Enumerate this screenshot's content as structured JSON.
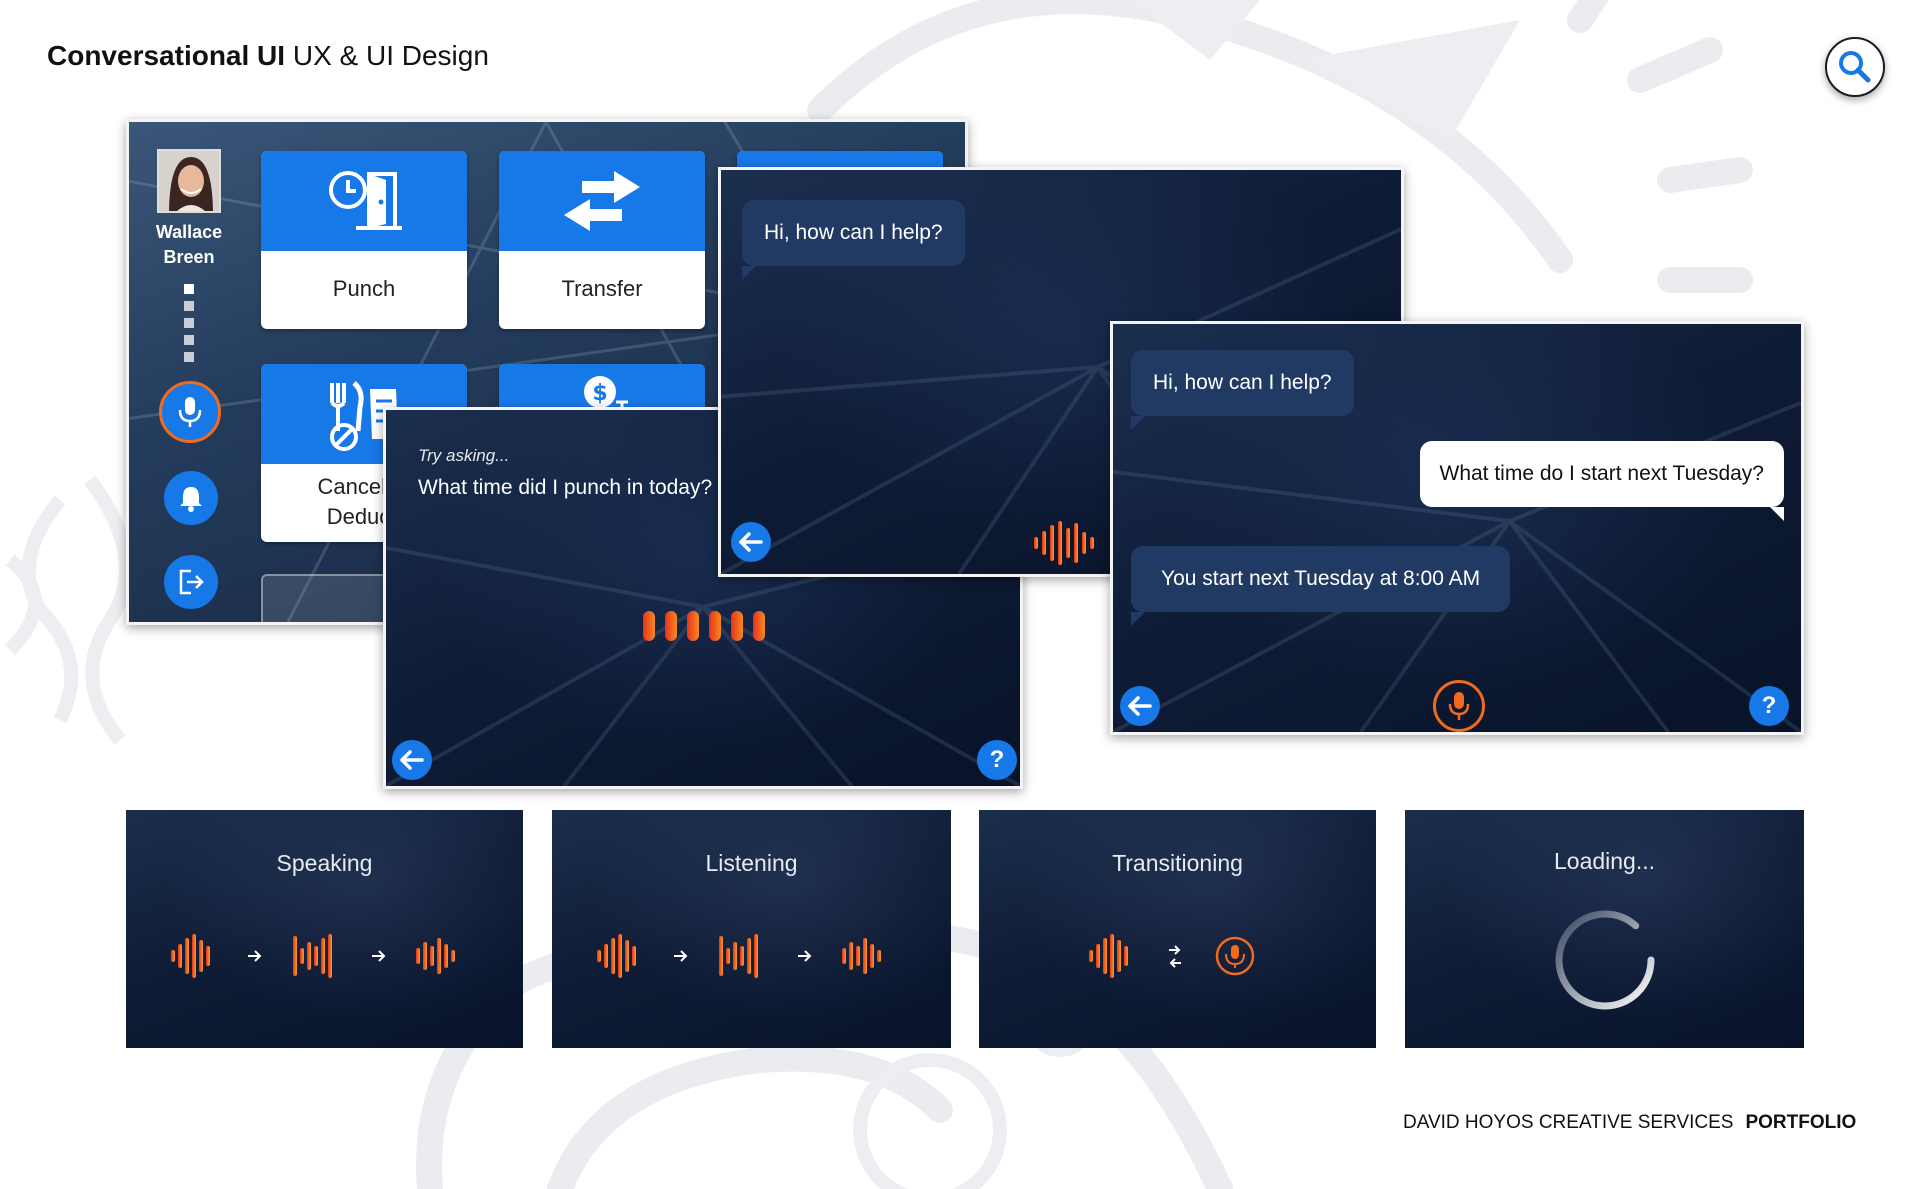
{
  "header": {
    "title_bold": "Conversational UI",
    "title_rest": " UX & UI Design"
  },
  "home_screen": {
    "user_first": "Wallace",
    "user_last": "Breen",
    "tiles": [
      {
        "label": "Punch"
      },
      {
        "label": "Transfer"
      },
      {
        "label": "Cancel M\nDeducti"
      }
    ]
  },
  "listen_screen": {
    "hint": "Try asking...",
    "suggestion": "What time did I punch in today?"
  },
  "greet_screen": {
    "greeting": "Hi, how can I help?"
  },
  "conversation": {
    "greeting": "Hi, how can I help?",
    "user_message": "What time do I start next Tuesday?",
    "reply": "You start next Tuesday at 8:00 AM",
    "help_label": "?"
  },
  "states": [
    {
      "title": "Speaking"
    },
    {
      "title": "Listening"
    },
    {
      "title": "Transitioning"
    },
    {
      "title": "Loading..."
    }
  ],
  "footer": {
    "company": "DAVID HOYOS CREATIVE SERVICES",
    "section": "PORTFOLIO"
  },
  "colors": {
    "accent_blue": "#1778e8",
    "voice_orange": "#f26a1b",
    "voice_red": "#e8321e",
    "screen_navy": "#0f1c36"
  },
  "icons": [
    "search-icon",
    "mic-icon",
    "bell-icon",
    "logout-icon",
    "clock-door-icon",
    "transfer-arrows-icon",
    "fork-knife-icon",
    "dollar-icon",
    "back-arrow-icon",
    "help-icon",
    "voice-wave-icon",
    "spinner-icon"
  ]
}
